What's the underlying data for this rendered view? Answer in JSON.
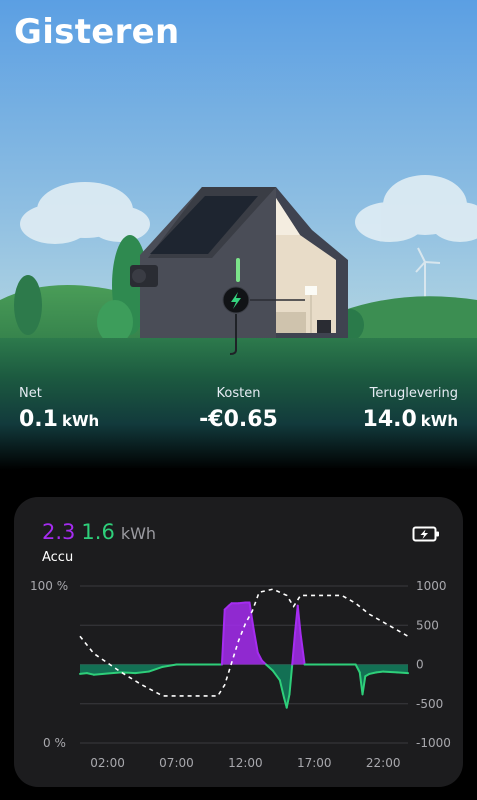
{
  "header": {
    "title": "Gisteren"
  },
  "stats": {
    "net": {
      "label": "Net",
      "value": "0.1",
      "unit": "kWh"
    },
    "kosten": {
      "label": "Kosten",
      "value": "-€0.65"
    },
    "teruglevering": {
      "label": "Teruglevering",
      "value": "14.0",
      "unit": "kWh"
    }
  },
  "battery_card": {
    "charged": "2.3",
    "discharged": "1.6",
    "unit": "kWh",
    "label": "Accu",
    "icon": "battery-charging-icon"
  },
  "colors": {
    "charge": "#a52cf0",
    "discharge": "#2ecf7a",
    "sky_top": "#5b9fe3",
    "card_bg": "#1c1c1e"
  },
  "chart_data": {
    "type": "area",
    "xlabel": "",
    "ylabel": "",
    "x_ticks": [
      "02:00",
      "07:00",
      "12:00",
      "17:00",
      "22:00"
    ],
    "y_left": {
      "ticks": [
        "100 %",
        "0 %"
      ],
      "range": [
        0,
        100
      ]
    },
    "y_right": {
      "ticks": [
        "1000",
        "500",
        "0",
        "-500",
        "-1000"
      ],
      "range": [
        -1000,
        1000
      ]
    },
    "series": [
      {
        "axis": "right",
        "x": [
          0.0,
          0.5,
          1.0,
          2.0,
          3.0,
          4.0,
          5.0,
          6.0,
          7.0,
          8.0,
          9.0,
          10.0,
          10.3,
          10.5,
          10.8,
          11.0,
          11.5,
          12.0,
          12.3,
          12.6,
          12.9,
          13.2,
          13.5,
          14.0,
          14.5,
          14.8,
          15.0,
          15.2,
          15.4,
          15.6,
          15.8,
          16.0,
          16.3,
          16.6,
          16.9,
          17.2,
          17.5,
          18.0,
          19.0,
          20.0,
          20.3,
          20.5,
          20.7,
          21.0,
          21.5,
          22.0,
          23.0,
          23.8
        ],
        "values": [
          -120,
          -110,
          -130,
          -115,
          -100,
          -110,
          -90,
          -30,
          0,
          0,
          0,
          0,
          0,
          700,
          750,
          780,
          780,
          790,
          790,
          450,
          150,
          50,
          0,
          -80,
          -200,
          -420,
          -550,
          -380,
          0,
          400,
          750,
          400,
          0,
          0,
          0,
          0,
          0,
          0,
          0,
          0,
          -100,
          -380,
          -150,
          -120,
          -100,
          -90,
          -100,
          -110
        ]
      },
      {
        "name": "",
        "axis": "left",
        "style": "dashed",
        "x": [
          0.0,
          1.0,
          2.0,
          3.0,
          4.5,
          6.0,
          7.0,
          8.0,
          9.0,
          10.0,
          10.5,
          11.0,
          11.5,
          12.0,
          12.5,
          13.0,
          14.0,
          15.0,
          15.5,
          16.0,
          17.0,
          18.0,
          19.0,
          20.0,
          21.0,
          22.0,
          23.0,
          23.8
        ],
        "values": [
          68,
          57,
          51,
          45,
          37,
          30,
          30,
          30,
          30,
          30,
          37,
          51,
          65,
          76,
          84,
          96,
          98,
          94,
          87,
          94,
          94,
          94,
          94,
          89,
          82,
          77,
          72,
          68
        ]
      }
    ]
  }
}
